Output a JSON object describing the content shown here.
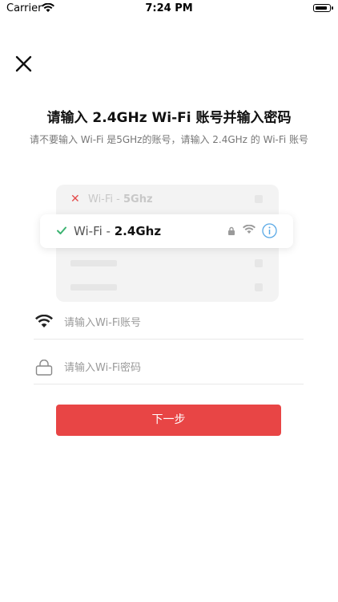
{
  "status_bar": {
    "carrier": "Carrier",
    "time": "7:24 PM"
  },
  "header": {
    "close_icon": "close-icon"
  },
  "main": {
    "title": "请输入 2.4GHz Wi-Fi 账号并输入密码",
    "subtitle": "请不要输入 Wi-Fi 是5GHz的账号，请输入 2.4GHz 的 Wi-Fi 账号"
  },
  "illustration": {
    "bad_prefix": "Wi-Fi - ",
    "bad_band": "5Ghz",
    "good_prefix": "Wi-Fi - ",
    "good_band": "2.4Ghz",
    "colors": {
      "bad": "#e44b4b",
      "good": "#3cb371",
      "info": "#5aa9e6"
    }
  },
  "form": {
    "wifi_placeholder": "请输入Wi-Fi账号",
    "password_placeholder": "请输入Wi-Fi密码",
    "next_label": "下一步"
  },
  "theme": {
    "accent": "#e84545"
  }
}
